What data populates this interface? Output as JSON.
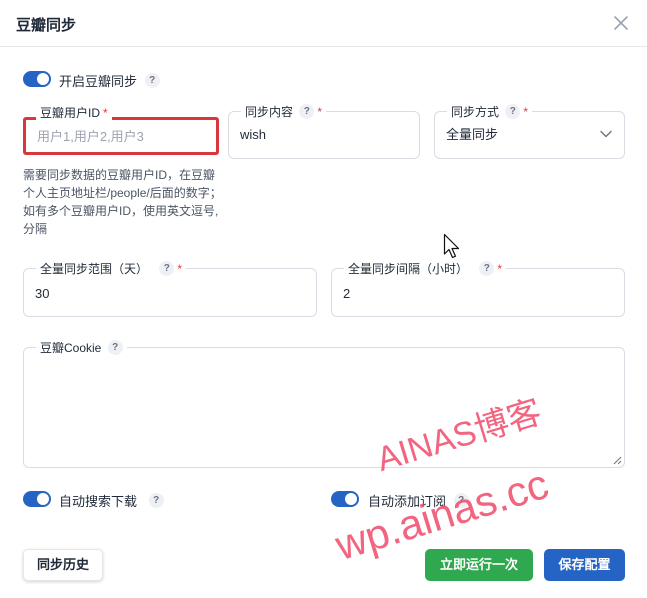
{
  "dialog": {
    "title": "豆瓣同步",
    "close_icon": "close-icon"
  },
  "enable_sync": {
    "label": "开启豆瓣同步",
    "on": true
  },
  "help_mark": "?",
  "required_mark": "*",
  "user_id": {
    "label": "豆瓣用户ID",
    "placeholder": "用户1,用户2,用户3",
    "value": "",
    "hint": "需要同步数据的豆瓣用户ID，在豆瓣个人主页地址栏/people/后面的数字；如有多个豆瓣用户ID，使用英文逗号,分隔"
  },
  "sync_content": {
    "label": "同步内容",
    "value": "wish"
  },
  "sync_mode": {
    "label": "同步方式",
    "value": "全量同步"
  },
  "full_range": {
    "label": "全量同步范围（天）",
    "value": "30"
  },
  "full_interval": {
    "label": "全量同步间隔（小时）",
    "value": "2"
  },
  "cookie": {
    "label": "豆瓣Cookie",
    "value": ""
  },
  "auto_search": {
    "label": "自动搜索下载",
    "on": true
  },
  "auto_subscribe": {
    "label": "自动添加订阅",
    "on": true
  },
  "buttons": {
    "history": "同步历史",
    "run_once": "立即运行一次",
    "save": "保存配置"
  },
  "watermark": {
    "line1": "AINAS博客",
    "line2": "wp.ainas.cc"
  },
  "colors": {
    "primary": "#2563c4",
    "success": "#2fa84f",
    "danger": "#d9363e",
    "watermark": "#f0506e"
  }
}
